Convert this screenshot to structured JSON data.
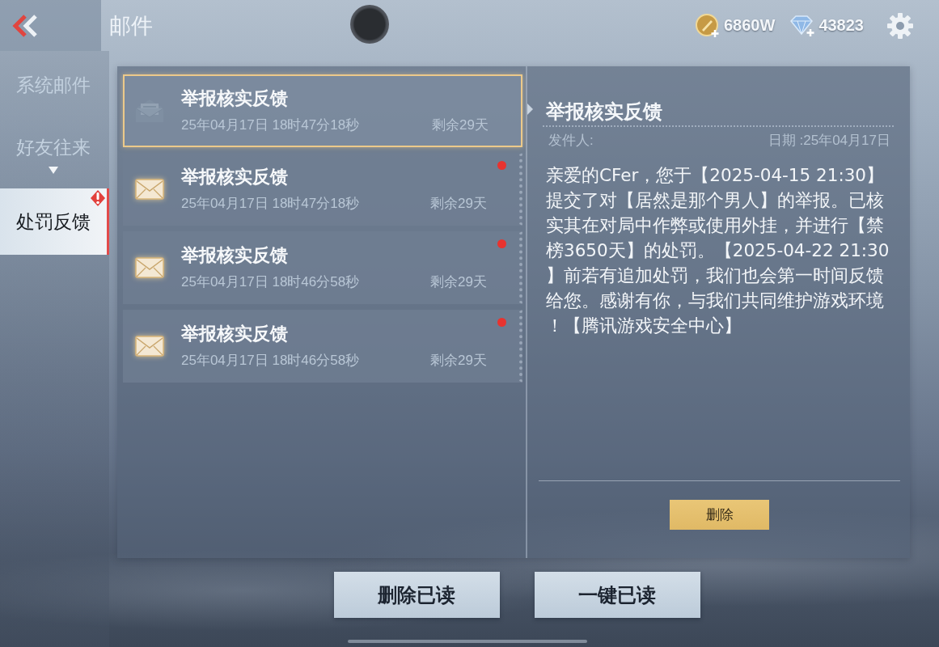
{
  "header": {
    "title": "邮件",
    "currencies": [
      {
        "kind": "coin",
        "amount": "6860W"
      },
      {
        "kind": "diamond",
        "amount": "43823"
      }
    ]
  },
  "sidebar": {
    "items": [
      {
        "label": "系统邮件",
        "selected": false,
        "dropdown": false,
        "alert": false
      },
      {
        "label": "好友往来",
        "selected": false,
        "dropdown": true,
        "alert": false
      },
      {
        "label": "处罚反馈",
        "selected": true,
        "dropdown": false,
        "alert": true
      }
    ]
  },
  "mail_list": [
    {
      "title": "举报核实反馈",
      "date": "25年04月17日 18时47分18秒",
      "remaining": "剩余29天",
      "selected": true,
      "unread": false
    },
    {
      "title": "举报核实反馈",
      "date": "25年04月17日 18时47分18秒",
      "remaining": "剩余29天",
      "selected": false,
      "unread": true
    },
    {
      "title": "举报核实反馈",
      "date": "25年04月17日 18时46分58秒",
      "remaining": "剩余29天",
      "selected": false,
      "unread": true
    },
    {
      "title": "举报核实反馈",
      "date": "25年04月17日 18时46分58秒",
      "remaining": "剩余29天",
      "selected": false,
      "unread": true
    }
  ],
  "detail": {
    "title": "举报核实反馈",
    "sender_label": "发件人:",
    "date": "日期 :25年04月17日",
    "body": "亲爱的CFer，您于【2025-04-15 21:30】提交了对【居然是那个男人】的举报。已核实其在对局中作弊或使用外挂，并进行【禁榜3650天】的处罚。【2025-04-22 21:30】前若有追加处罚，我们也会第一时间反馈给您。感谢有你，与我们共同维护游戏环境！【腾讯游戏安全中心】",
    "delete_button": "删除"
  },
  "buttons": [
    "删除已读",
    "一键已读"
  ]
}
